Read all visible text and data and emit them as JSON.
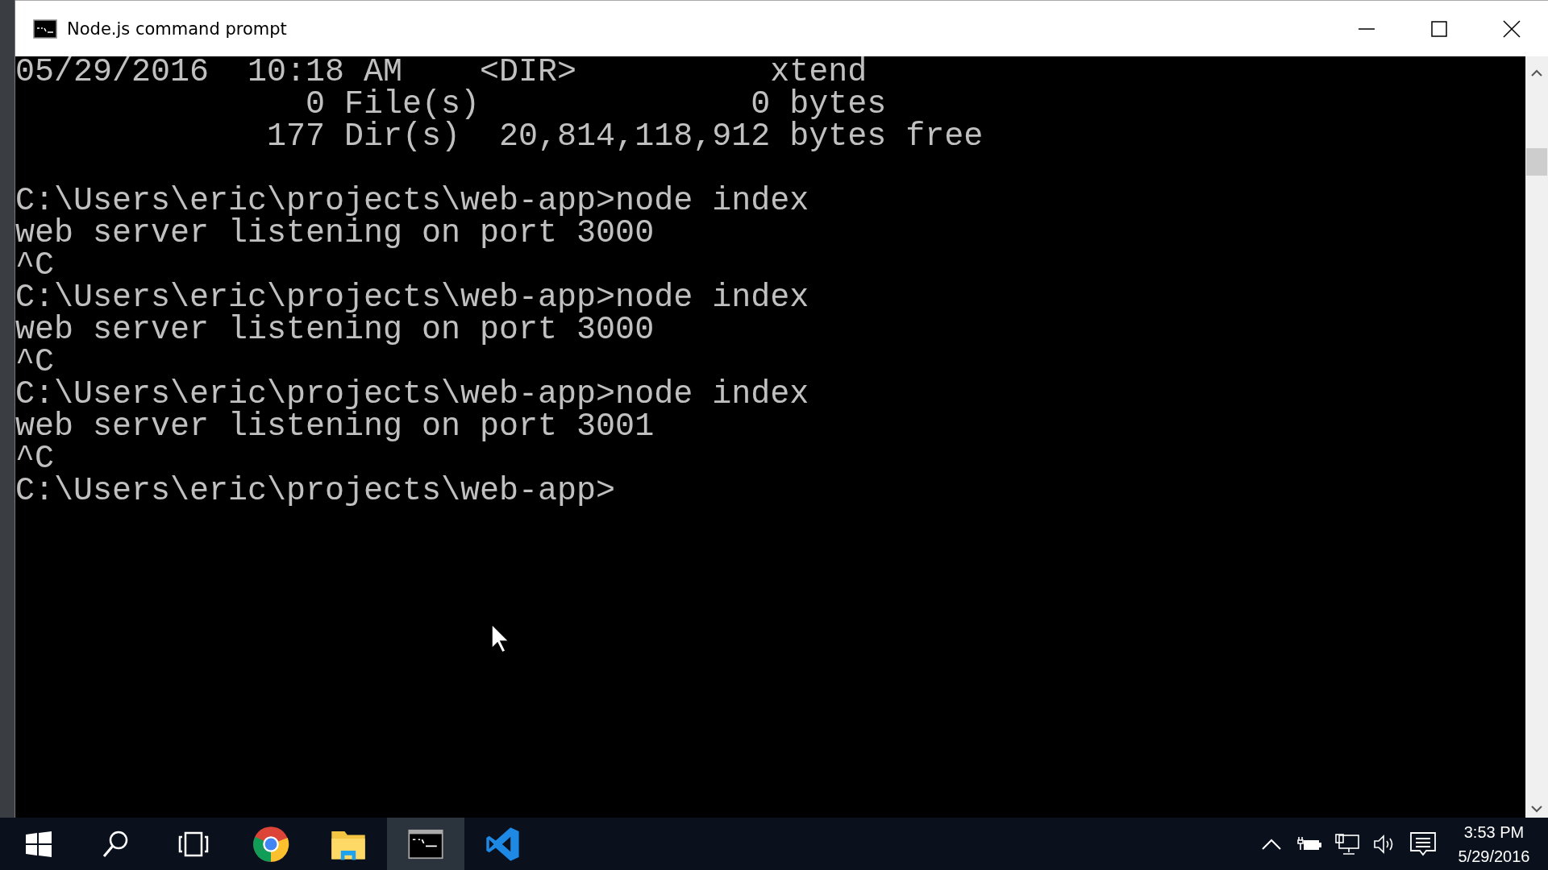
{
  "window": {
    "title": "Node.js command prompt"
  },
  "console": {
    "blocks": [
      {
        "lines": [
          "05/29/2016  10:18 AM    <DIR>          xtend",
          "               0 File(s)              0 bytes",
          "             177 Dir(s)  20,814,118,912 bytes free"
        ]
      },
      {
        "lines": [
          "C:\\Users\\eric\\projects\\web-app>node index",
          "web server listening on port 3000",
          "^C",
          "C:\\Users\\eric\\projects\\web-app>node index",
          "web server listening on port 3000",
          "^C",
          "C:\\Users\\eric\\projects\\web-app>node index",
          "web server listening on port 3001",
          "^C",
          "C:\\Users\\eric\\projects\\web-app>"
        ]
      }
    ]
  },
  "taskbar": {
    "items": [
      {
        "kind": "start",
        "selected": false
      },
      {
        "kind": "search",
        "selected": false
      },
      {
        "kind": "taskview",
        "selected": false
      },
      {
        "kind": "chrome",
        "selected": false
      },
      {
        "kind": "explorer",
        "selected": false
      },
      {
        "kind": "terminal",
        "selected": true
      },
      {
        "kind": "vscode",
        "selected": false
      }
    ],
    "tray": [
      {
        "kind": "caret"
      },
      {
        "kind": "battery"
      },
      {
        "kind": "network"
      },
      {
        "kind": "volume"
      },
      {
        "kind": "notifications"
      }
    ],
    "clock": {
      "time": "3:53 PM",
      "date": "5/29/2016"
    }
  }
}
